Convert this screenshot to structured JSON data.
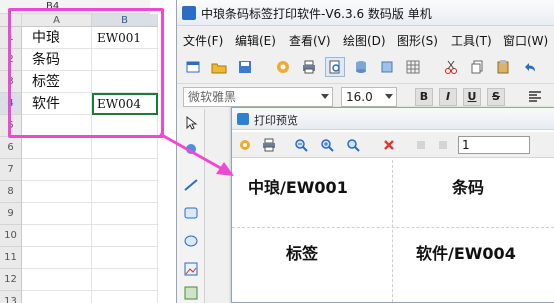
{
  "spreadsheet": {
    "name_box": "B4",
    "columns": [
      "A",
      "B"
    ],
    "rows": [
      {
        "num": "1",
        "a": "中琅",
        "b": "EW001"
      },
      {
        "num": "2",
        "a": "条码",
        "b": ""
      },
      {
        "num": "3",
        "a": "标签",
        "b": ""
      },
      {
        "num": "4",
        "a": "软件",
        "b": "EW004"
      },
      {
        "num": "5",
        "a": "",
        "b": ""
      },
      {
        "num": "6",
        "a": "",
        "b": ""
      },
      {
        "num": "7",
        "a": "",
        "b": ""
      },
      {
        "num": "8",
        "a": "",
        "b": ""
      },
      {
        "num": "9",
        "a": "",
        "b": ""
      },
      {
        "num": "10",
        "a": "",
        "b": ""
      },
      {
        "num": "11",
        "a": "",
        "b": ""
      },
      {
        "num": "12",
        "a": "",
        "b": ""
      },
      {
        "num": "13",
        "a": "",
        "b": ""
      }
    ],
    "selection_color": "#1f7a3a"
  },
  "app": {
    "title": "中琅条码标签打印软件-V6.3.6 数码版 单机",
    "menu": [
      "文件(F)",
      "编辑(E)",
      "查看(V)",
      "绘图(D)",
      "图形(S)",
      "工具(T)",
      "窗口(W)"
    ],
    "font_name": "微软雅黑",
    "font_size": "16.0",
    "format_buttons": [
      "B",
      "I",
      "U",
      "S"
    ]
  },
  "preview": {
    "title": "打印预览",
    "page_number": "1",
    "cells": [
      {
        "text": "中琅/EW001"
      },
      {
        "text": "条码"
      },
      {
        "text": "标签"
      },
      {
        "text": "软件/EW004"
      }
    ]
  },
  "colors": {
    "highlight_pink": "#ee49d3",
    "accent_blue": "#2b6cc4"
  }
}
